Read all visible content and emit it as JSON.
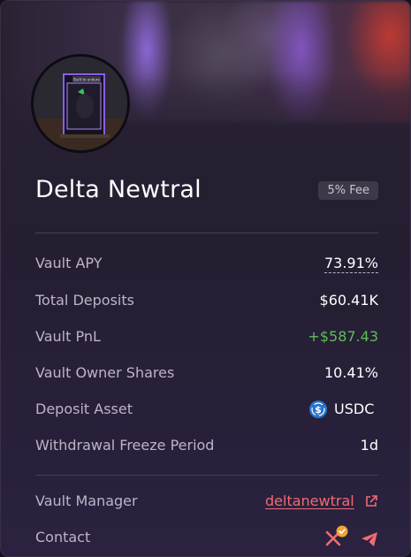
{
  "vault": {
    "name": "Delta Newtral",
    "fee_badge": "5% Fee",
    "avatar_sign": "Built to endure"
  },
  "stats": [
    {
      "label": "Vault APY",
      "value": "73.91%"
    },
    {
      "label": "Total Deposits",
      "value": "$60.41K"
    },
    {
      "label": "Vault PnL",
      "value": "+$587.43"
    },
    {
      "label": "Vault Owner Shares",
      "value": "10.41%"
    },
    {
      "label": "Deposit Asset",
      "value": "USDC",
      "icon": "usdc-icon"
    },
    {
      "label": "Withdrawal Freeze Period",
      "value": "1d"
    }
  ],
  "manager": {
    "label": "Vault Manager",
    "handle": "deltanewtral",
    "icon": "external-link-icon"
  },
  "contact": {
    "label": "Contact",
    "icons": [
      "x-icon",
      "verified-badge-icon",
      "telegram-icon"
    ]
  },
  "colors": {
    "positive": "#5fbd55",
    "link": "#f16b72",
    "usdc": "#2775ca",
    "verified": "#f0a43a"
  }
}
